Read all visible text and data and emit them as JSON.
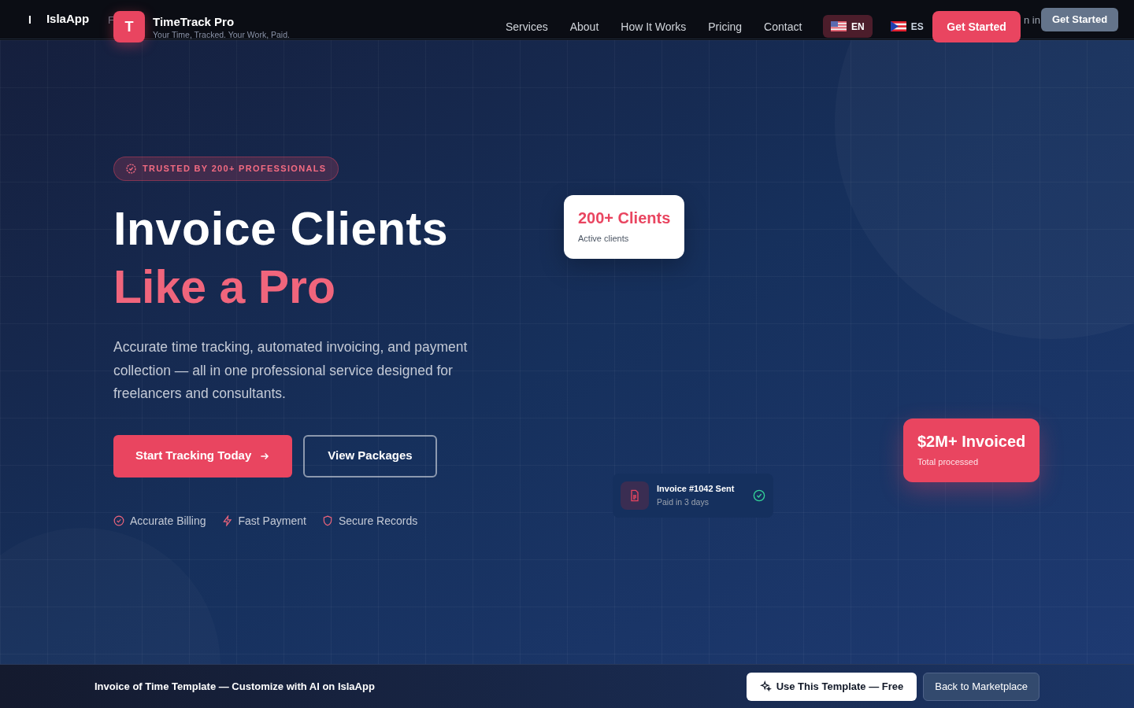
{
  "platform_bar": {
    "mark": "I",
    "brand": "IslaApp",
    "fragments": [
      "F"
    ],
    "sign_in_fragment": "n in",
    "cta": "Get Started"
  },
  "header": {
    "logo_letter": "T",
    "title": "TimeTrack Pro",
    "tagline": "Your Time, Tracked. Your Work, Paid.",
    "nav": [
      "Services",
      "About",
      "How It Works",
      "Pricing",
      "Contact"
    ],
    "languages": [
      {
        "code": "EN",
        "kind": "us",
        "selected": true
      },
      {
        "code": "ES",
        "kind": "pr",
        "selected": false
      }
    ],
    "cta": "Get Started"
  },
  "hero": {
    "badge": "TRUSTED BY 200+ PROFESSIONALS",
    "title_line_1": "Invoice Clients",
    "title_line_2": "Like a Pro",
    "description": "Accurate time tracking, automated invoicing, and payment collection — all in one professional service designed for freelancers and consultants.",
    "primary_button": "Start Tracking Today",
    "secondary_button": "View Packages",
    "features": [
      {
        "label": "Accurate Billing",
        "kind": "check"
      },
      {
        "label": "Fast Payment",
        "kind": "bolt"
      },
      {
        "label": "Secure Records",
        "kind": "shield"
      }
    ]
  },
  "stat_cards": [
    {
      "value": "200+ Clients",
      "caption": "Active clients",
      "kind": "light"
    },
    {
      "value": "$2M+ Invoiced",
      "caption": "Total processed",
      "kind": "accent"
    }
  ],
  "notification": {
    "title": "Invoice #1042 Sent",
    "subtitle": "Paid in 3 days"
  },
  "footer_bar": {
    "text": "Invoice of Time Template — Customize with AI on IslaApp",
    "primary": "Use This Template — Free",
    "secondary": "Back to Marketplace"
  }
}
